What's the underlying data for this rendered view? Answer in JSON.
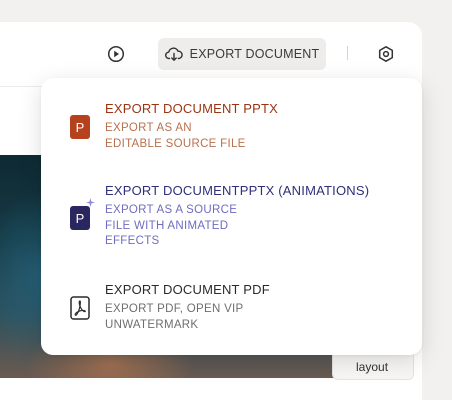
{
  "toolbar": {
    "export_label": "EXPORT DOCUMENT",
    "play_icon": "play-circle-icon",
    "export_icon": "cloud-download-icon",
    "settings_icon": "hexagon-settings-icon"
  },
  "export_menu": {
    "items": [
      {
        "title": "EXPORT DOCUMENT PPTX",
        "desc_lines": [
          "EXPORT AS AN",
          "EDITABLE SOURCE FILE"
        ],
        "icon_letter": "P",
        "icon": "powerpoint-icon",
        "title_color": "#9b3412",
        "desc_color": "#b8704e",
        "icon_color": "#b5421c"
      },
      {
        "title": "EXPORT DOCUMENTPPTX (ANIMATIONS)",
        "desc_lines": [
          "EXPORT AS A SOURCE",
          "FILE WITH ANIMATED",
          "EFFECTS"
        ],
        "icon_letter": "P",
        "icon": "powerpoint-animated-icon",
        "title_color": "#2f2f7a",
        "desc_color": "#6f6dbf",
        "icon_color": "#2a2660"
      },
      {
        "title": "EXPORT DOCUMENT PDF",
        "desc_lines": [
          "EXPORT PDF, OPEN VIP",
          "UNWATERMARK"
        ],
        "icon": "pdf-icon",
        "title_color": "#2a2a2a",
        "desc_color": "#6e6e6e"
      }
    ]
  },
  "layout_card": {
    "label": "layout"
  }
}
